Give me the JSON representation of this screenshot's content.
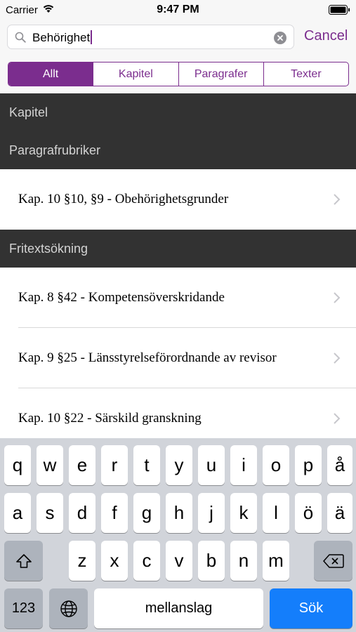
{
  "status_bar": {
    "carrier": "Carrier",
    "time": "9:47 PM"
  },
  "search": {
    "value": "Behörighet",
    "cancel_label": "Cancel"
  },
  "segments": [
    {
      "label": "Allt",
      "active": true
    },
    {
      "label": "Kapitel",
      "active": false
    },
    {
      "label": "Paragrafer",
      "active": false
    },
    {
      "label": "Texter",
      "active": false
    }
  ],
  "sections": {
    "kapitel": "Kapitel",
    "paragrafrubriker": "Paragrafrubriker",
    "fritext": "Fritextsökning"
  },
  "results": {
    "paragraf": [
      "Kap. 10 §10, §9 - Obehörighetsgrunder"
    ],
    "fritext": [
      "Kap. 8 §42 - Kompetensöverskridande",
      "Kap. 9 §25 - Länsstyrelseförordnande av revisor",
      "Kap. 10 §22 - Särskild granskning"
    ]
  },
  "keyboard": {
    "row1": [
      "q",
      "w",
      "e",
      "r",
      "t",
      "y",
      "u",
      "i",
      "o",
      "p",
      "å"
    ],
    "row2": [
      "a",
      "s",
      "d",
      "f",
      "g",
      "h",
      "j",
      "k",
      "l",
      "ö",
      "ä"
    ],
    "row3": [
      "z",
      "x",
      "c",
      "v",
      "b",
      "n",
      "m"
    ],
    "numbers_label": "123",
    "space_label": "mellanslag",
    "search_label": "Sök",
    "accent_color": "#147efb"
  },
  "theme": {
    "accent": "#7b2d8e",
    "section_bg": "#323232"
  }
}
